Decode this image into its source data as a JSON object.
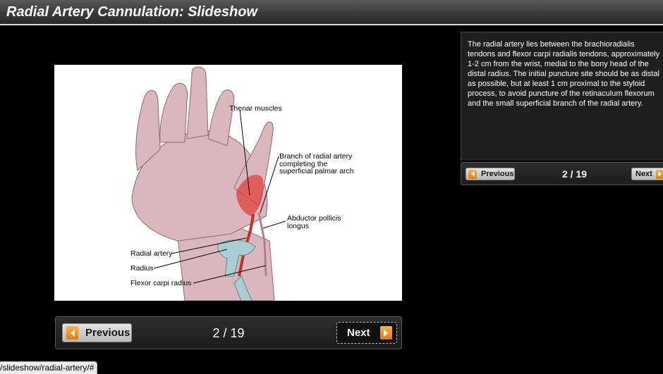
{
  "window": {
    "title": "Radial Artery Cannulation: Slideshow"
  },
  "figure": {
    "labels": {
      "thenar": "Thenar muscles",
      "branch_1": "Branch of radial artery",
      "branch_2": "completing the",
      "branch_3": "superficial palmar arch",
      "abductor_1": "Abductor pollicis",
      "abductor_2": "longus",
      "radial_artery": "Radial artery",
      "radius": "Radius",
      "flexor": "Flexor carpi radius"
    }
  },
  "main_nav": {
    "previous_label": "Previous",
    "next_label": "Next",
    "counter": "2 / 19"
  },
  "caption": {
    "text": "The radial artery lies between the brachioradialis tendons and flexor carpi radialis tendons, approximately 1-2 cm from the wrist, medial to the bony head of the distal radius. The initial puncture site should be as distal as possible, but at least 1 cm proximal to the styloid process, to avoid puncture of the retinaculum flexorum and the small superficial branch of the radial artery."
  },
  "side_nav": {
    "previous_label": "Previous",
    "next_label": "Next",
    "counter": "2 / 19"
  },
  "status_bar": {
    "url": "/slideshow/radial-artery/#"
  },
  "colors": {
    "accent_orange": "#f08a1c",
    "panel_bg": "#1f1f1f",
    "skin": "#d9b7bd",
    "artery": "#e0403a",
    "bone": "#a9cfd3"
  },
  "icons": {
    "prev": "triangle-left-icon",
    "next": "triangle-right-icon"
  }
}
